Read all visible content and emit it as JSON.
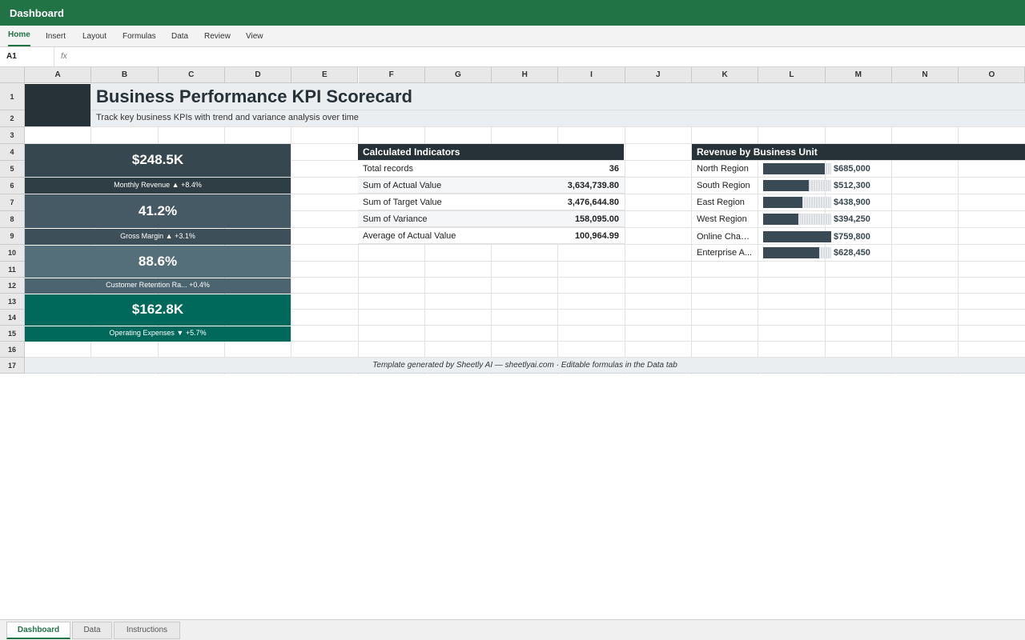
{
  "app": {
    "title": "Dashboard"
  },
  "ribbon": {
    "tabs": [
      "Home",
      "Insert",
      "Layout",
      "Formulas",
      "Data",
      "Review",
      "View"
    ]
  },
  "formula_bar": {
    "cell_ref": "A1",
    "fx": "fx",
    "value": ""
  },
  "columns": [
    "A",
    "B",
    "C",
    "D",
    "E",
    "F",
    "G",
    "H",
    "I",
    "J",
    "K",
    "L",
    "M",
    "N",
    "O"
  ],
  "rows": [
    "1",
    "2",
    "3",
    "4",
    "5",
    "6",
    "7",
    "8",
    "9",
    "10",
    "11",
    "12",
    "13",
    "14",
    "15",
    "16",
    "17"
  ],
  "header": {
    "title": "Business Performance KPI Scorecard",
    "subtitle": "Track key business KPIs with trend and variance analysis over time"
  },
  "kpis": [
    {
      "value": "$248.5K",
      "label": "Monthly Revenue ▲ +8.4%",
      "color": "#37474f",
      "label_color": "#2f3d45"
    },
    {
      "value": "41.2%",
      "label": "Gross Margin ▲ +3.1%",
      "color": "#455a64",
      "label_color": "#3d4f58"
    },
    {
      "value": "88.6%",
      "label": "Customer Retention Ra... +0.4%",
      "color": "#546e7a",
      "label_color": "#4c646f"
    },
    {
      "value": "$162.8K",
      "label": "Operating Expenses ▼ +5.7%",
      "color": "#00695c",
      "label_color": "#00695c"
    }
  ],
  "calculated": {
    "title": "Calculated Indicators",
    "rows": [
      {
        "label": "Total records",
        "value": "36"
      },
      {
        "label": "Sum of Actual Value",
        "value": "3,634,739.80"
      },
      {
        "label": "Sum of Target Value",
        "value": "3,476,644.80"
      },
      {
        "label": "Sum of Variance",
        "value": "158,095.00"
      },
      {
        "label": "Average of Actual Value",
        "value": "100,964.99"
      }
    ]
  },
  "revenue": {
    "title": "Revenue by Business Unit",
    "max": 759800,
    "rows": [
      {
        "label": "North Region",
        "amount": 685000,
        "value": "$685,000"
      },
      {
        "label": "South Region",
        "amount": 512300,
        "value": "$512,300"
      },
      {
        "label": "East Region",
        "amount": 438900,
        "value": "$438,900"
      },
      {
        "label": "West Region",
        "amount": 394250,
        "value": "$394,250"
      },
      {
        "label": "Online Chan...",
        "amount": 759800,
        "value": "$759,800"
      },
      {
        "label": "Enterprise A...",
        "amount": 628450,
        "value": "$628,450"
      }
    ]
  },
  "footer": {
    "text": "Template generated by Sheetly AI — sheetlyai.com · Editable formulas in the Data tab"
  },
  "sheet_tabs": [
    "Dashboard",
    "Data",
    "Instructions"
  ],
  "colors": {
    "brand": "#217346",
    "header_dark": "#263238",
    "bar": "#3a4a55"
  }
}
